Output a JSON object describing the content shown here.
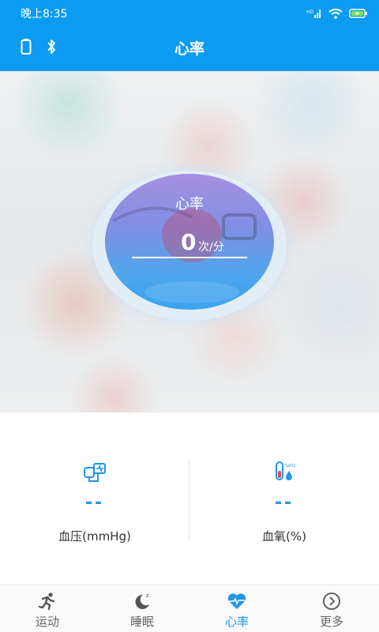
{
  "status_bar": {
    "time": "晚上8:35",
    "icons": [
      "hd-signal-icon",
      "wifi-icon",
      "battery-charging-icon"
    ],
    "background": "#0b9bf0"
  },
  "header": {
    "title": "心率",
    "left_icons": [
      "battery-icon",
      "bluetooth-icon"
    ]
  },
  "gauge": {
    "label": "心率",
    "value": "0",
    "unit": "次/分"
  },
  "metrics": [
    {
      "icon": "blood-pressure-icon",
      "value": "--",
      "label": "血压(mmHg)"
    },
    {
      "icon": "blood-oxygen-icon",
      "value": "--",
      "label": "血氧(%)"
    }
  ],
  "bottom_nav": {
    "items": [
      {
        "label": "运动",
        "icon": "running-icon",
        "active": false
      },
      {
        "label": "睡眠",
        "icon": "sleep-moon-icon",
        "active": false
      },
      {
        "label": "心率",
        "icon": "heart-rate-icon",
        "active": true
      },
      {
        "label": "更多",
        "icon": "more-chevron-icon",
        "active": false
      }
    ]
  },
  "colors": {
    "primary": "#0b9bf0",
    "accent": "#1f96e9",
    "inactive": "#666666"
  }
}
